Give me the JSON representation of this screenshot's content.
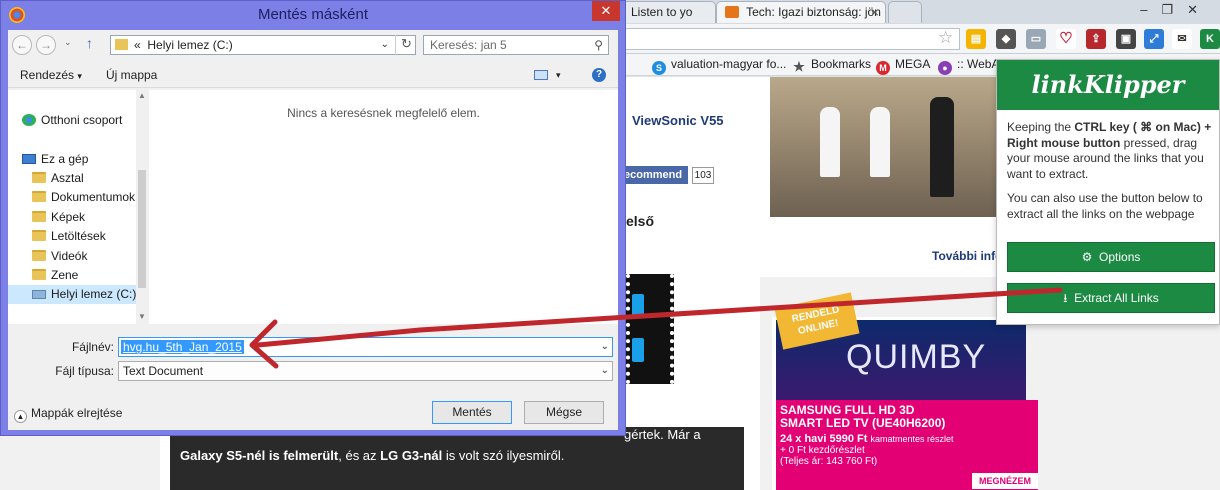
{
  "browser": {
    "tabs": [
      {
        "label": "Listen to yo"
      },
      {
        "label": "Tech: Igazi biztonság: jön"
      }
    ],
    "bookmarks": [
      {
        "label": "valuation-magyar fo...",
        "icon": "skype-icon"
      },
      {
        "label": "Bookmarks",
        "icon": "star-icon"
      },
      {
        "label": "MEGA",
        "icon": "mega-icon"
      },
      {
        "label": ":: WebA",
        "icon": "webapp-icon"
      }
    ],
    "page": {
      "headline_snippet": "ViewSonic V55",
      "recommend_label": "ecommend",
      "recommend_count": "103",
      "elso_snippet": "első",
      "tovabbi_snippet": "További info",
      "ad_ribbon": "RENDELD ONLINE!",
      "band_name": "QUIMBY",
      "samsung_title": "SAMSUNG FULL HD 3D SMART LED TV (UE40H6200)",
      "samsung_price": "24 x havi 5990 Ft",
      "samsung_price_note": "kamatmentes részlet",
      "samsung_extra": "+ 0 Ft kezdőrészlet",
      "samsung_total": "(Teljes ár: 143 760 Ft)",
      "samsung_btn": "MEGNÉZEM",
      "article_line1_tail": "gértek. Már a",
      "article_bold1": "Galaxy S5-nél is felmerült",
      "article_mid": ", és az ",
      "article_bold2": "LG G3-nál",
      "article_tail": " is volt szó ilyesmiről."
    }
  },
  "dialog": {
    "title": "Mentés másként",
    "breadcrumb_sep": "«",
    "address": "Helyi lemez (C:)",
    "search_placeholder": "Keresés: jan 5",
    "organize_label": "Rendezés",
    "new_folder_label": "Új mappa",
    "nav_items": [
      {
        "label": "Otthoni csoport",
        "icon": "homegroup-icon"
      },
      {
        "label": "Ez a gép",
        "icon": "computer-icon"
      },
      {
        "label": "Asztal",
        "icon": "folder-icon"
      },
      {
        "label": "Dokumentumok",
        "icon": "folder-icon"
      },
      {
        "label": "Képek",
        "icon": "folder-icon"
      },
      {
        "label": "Letöltések",
        "icon": "folder-icon"
      },
      {
        "label": "Videók",
        "icon": "folder-icon"
      },
      {
        "label": "Zene",
        "icon": "folder-icon"
      },
      {
        "label": "Helyi lemez (C:)",
        "icon": "drive-icon"
      }
    ],
    "empty_message": "Nincs a keresésnek megfelelő elem.",
    "filename_label": "Fájlnév:",
    "filename_value": "hvg.hu_5th_Jan_2015",
    "filetype_label": "Fájl típusa:",
    "filetype_value": "Text Document",
    "hide_folders_label": "Mappák elrejtése",
    "save_label": "Mentés",
    "cancel_label": "Mégse"
  },
  "linkklipper": {
    "brand": "linkKlipper",
    "instruction_pre": "Keeping the ",
    "instruction_key": "CTRL key ( ⌘ on Mac) + Right mouse button",
    "instruction_post": " pressed, drag your mouse around the links that you want to extract.",
    "secondary": "You can also use the button below to extract all the links on the webpage",
    "options_label": "Options",
    "extract_label": "Extract All Links",
    "brand_color": "#1c8a43"
  },
  "annotation": {
    "arrow_color": "#c0272d"
  }
}
